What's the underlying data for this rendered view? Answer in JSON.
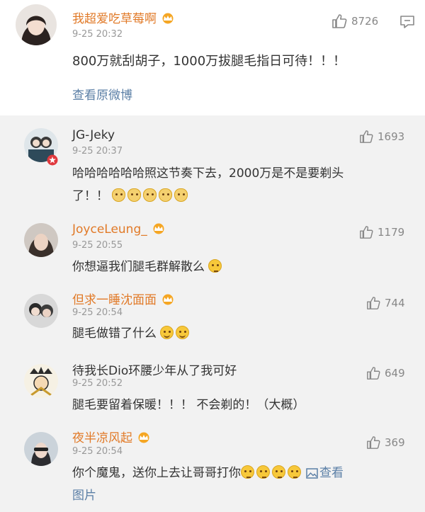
{
  "main_post": {
    "username": "我超爱吃草莓啊",
    "time": "9-25 20:32",
    "likes": "8726",
    "text": "800万就刮胡子，1000万拔腿毛指日可待！！！",
    "view_original": "查看原微博"
  },
  "replies": [
    {
      "username": "JG-Jeky",
      "time": "9-25 20:37",
      "likes": "1693",
      "text_line1": "哈哈哈哈哈哈照这节奏下去，2000万是不是要剃头",
      "text_line2": "了！！"
    },
    {
      "username": "JoyceLeung_",
      "time": "9-25 20:55",
      "likes": "1179",
      "text": "你想逼我们腿毛群解散么"
    },
    {
      "username": "但求一睡沈面面",
      "time": "9-25 20:54",
      "likes": "744",
      "text": "腿毛做错了什么"
    },
    {
      "username": "待我长Dio环腰少年从了我可好",
      "time": "9-25 20:52",
      "likes": "649",
      "text": "腿毛要留着保暖！！！ 不会剃的！（大概）"
    },
    {
      "username": "夜半凉风起",
      "time": "9-25 20:54",
      "likes": "369",
      "text": "你个魔鬼，送你上去让哥哥打你",
      "view_image_1": "查看",
      "view_image_2": "图片"
    }
  ],
  "icons": {
    "like": "thumbs-up-icon",
    "comment": "comment-icon",
    "member": "crown-icon",
    "image": "image-icon"
  },
  "colors": {
    "username_vip": "#e17a28",
    "link": "#5b7fa6",
    "meta": "#999999",
    "thread_bg": "#f2f2f2"
  }
}
